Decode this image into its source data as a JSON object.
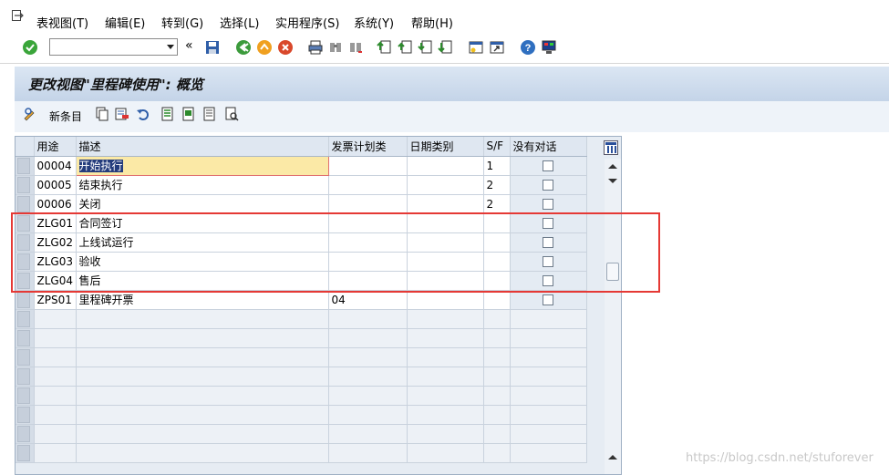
{
  "menubar": {
    "items": [
      "表视图(T)",
      "编辑(E)",
      "转到(G)",
      "选择(L)",
      "实用程序(S)",
      "系统(Y)",
      "帮助(H)"
    ]
  },
  "toolbar": {
    "command_value": "",
    "icons": [
      "enter-icon",
      "back-icon",
      "save-icon",
      "back-nav-icon",
      "exit-icon",
      "cancel-icon",
      "print-icon",
      "find-icon",
      "find-next-icon",
      "first-page-icon",
      "prev-page-icon",
      "next-page-icon",
      "last-page-icon",
      "new-session-icon",
      "shortcut-icon",
      "help-icon",
      "layout-icon"
    ]
  },
  "title": "更改视图\"里程碑使用\": 概览",
  "app_toolbar": {
    "new_entries_label": "新条目"
  },
  "table": {
    "headers": [
      "用途",
      "描述",
      "发票计划类",
      "日期类别",
      "S/F",
      "没有对话"
    ],
    "rows": [
      {
        "usage": "00004",
        "description": "开始执行",
        "billing_plan": "",
        "date_cat": "",
        "sf": "1",
        "no_dialog": false
      },
      {
        "usage": "00005",
        "description": "结束执行",
        "billing_plan": "",
        "date_cat": "",
        "sf": "2",
        "no_dialog": false
      },
      {
        "usage": "00006",
        "description": "关闭",
        "billing_plan": "",
        "date_cat": "",
        "sf": "2",
        "no_dialog": false
      },
      {
        "usage": "ZLG01",
        "description": "合同签订",
        "billing_plan": "",
        "date_cat": "",
        "sf": "",
        "no_dialog": false
      },
      {
        "usage": "ZLG02",
        "description": "上线试运行",
        "billing_plan": "",
        "date_cat": "",
        "sf": "",
        "no_dialog": false
      },
      {
        "usage": "ZLG03",
        "description": "验收",
        "billing_plan": "",
        "date_cat": "",
        "sf": "",
        "no_dialog": false
      },
      {
        "usage": "ZLG04",
        "description": "售后",
        "billing_plan": "",
        "date_cat": "",
        "sf": "",
        "no_dialog": false
      },
      {
        "usage": "ZPS01",
        "description": "里程碑开票",
        "billing_plan": "04",
        "date_cat": "",
        "sf": "",
        "no_dialog": false
      }
    ]
  },
  "watermark": "https://blog.csdn.net/stuforever",
  "colors": {
    "title_bg": "#c4d4e8",
    "highlight_border": "#e53935",
    "focus_cell": "#fbe9a6"
  }
}
